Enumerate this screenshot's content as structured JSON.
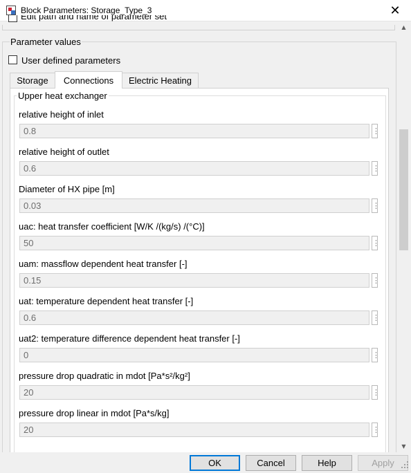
{
  "window": {
    "title": "Block Parameters: Storage_Type_3",
    "close_glyph": "✕"
  },
  "partial_row": {
    "label": "Edit path and name of parameter set"
  },
  "section": {
    "title": "Parameter values",
    "user_defined_label": "User defined parameters",
    "user_defined_checked": false
  },
  "tabs": [
    {
      "label": "Storage",
      "active": false
    },
    {
      "label": "Connections",
      "active": true
    },
    {
      "label": "Electric Heating",
      "active": false
    }
  ],
  "group": {
    "title": "Upper heat exchanger"
  },
  "params": [
    {
      "label": "relative height of inlet",
      "value": "0.8"
    },
    {
      "label": "relative height of outlet",
      "value": "0.6"
    },
    {
      "label": "Diameter of HX pipe [m]",
      "value": "0.03"
    },
    {
      "label": "uac: heat transfer coefficient [W/K /(kg/s) /(°C)]",
      "value": "50"
    },
    {
      "label": "uam: massflow dependent heat transfer [-]",
      "value": "0.15"
    },
    {
      "label": "uat: temperature dependent heat transfer [-]",
      "value": "0.6"
    },
    {
      "label": "uat2: temperature difference dependent heat transfer [-]",
      "value": "0"
    },
    {
      "label": "pressure drop quadratic in mdot [Pa*s²/kg²]",
      "value": "20"
    },
    {
      "label": "pressure drop linear in mdot [Pa*s/kg]",
      "value": "20"
    }
  ],
  "param_menu_glyph": "⋮",
  "scroll": {
    "up_glyph": "▲",
    "down_glyph": "▼"
  },
  "buttons": {
    "ok": "OK",
    "cancel": "Cancel",
    "help": "Help",
    "apply": "Apply"
  },
  "colors": {
    "accent": "#0078d7",
    "field_bg": "#f0f0f0",
    "field_text": "#6d6d6d"
  }
}
